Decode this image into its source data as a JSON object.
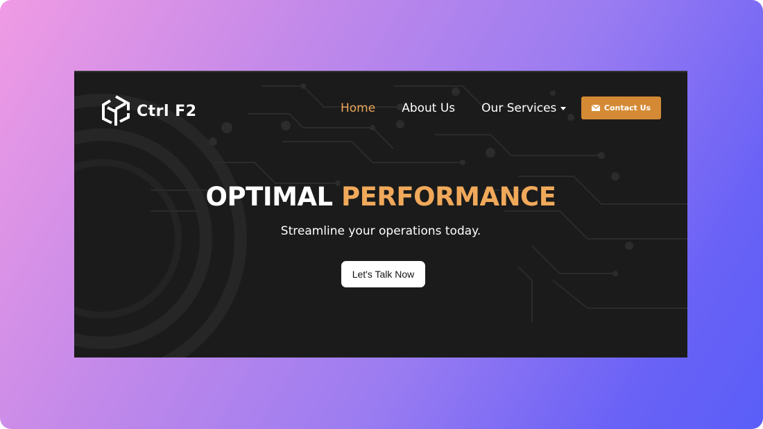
{
  "brand": {
    "name": "Ctrl F2"
  },
  "nav": {
    "items": [
      {
        "label": "Home",
        "active": true
      },
      {
        "label": "About Us",
        "active": false
      },
      {
        "label": "Our Services",
        "active": false,
        "has_dropdown": true
      }
    ],
    "contact_label": "Contact Us",
    "contact_icon": "envelope-icon"
  },
  "hero": {
    "title_plain": "OPTIMAL",
    "title_accent": "PERFORMANCE",
    "subtitle": "Streamline your operations today.",
    "cta_label": "Let's Talk Now"
  },
  "colors": {
    "accent": "#f0a95a",
    "button": "#d48a34",
    "site_bg": "#1b1b1b",
    "gradient_start": "#f09be4",
    "gradient_end": "#5a5ef8"
  }
}
